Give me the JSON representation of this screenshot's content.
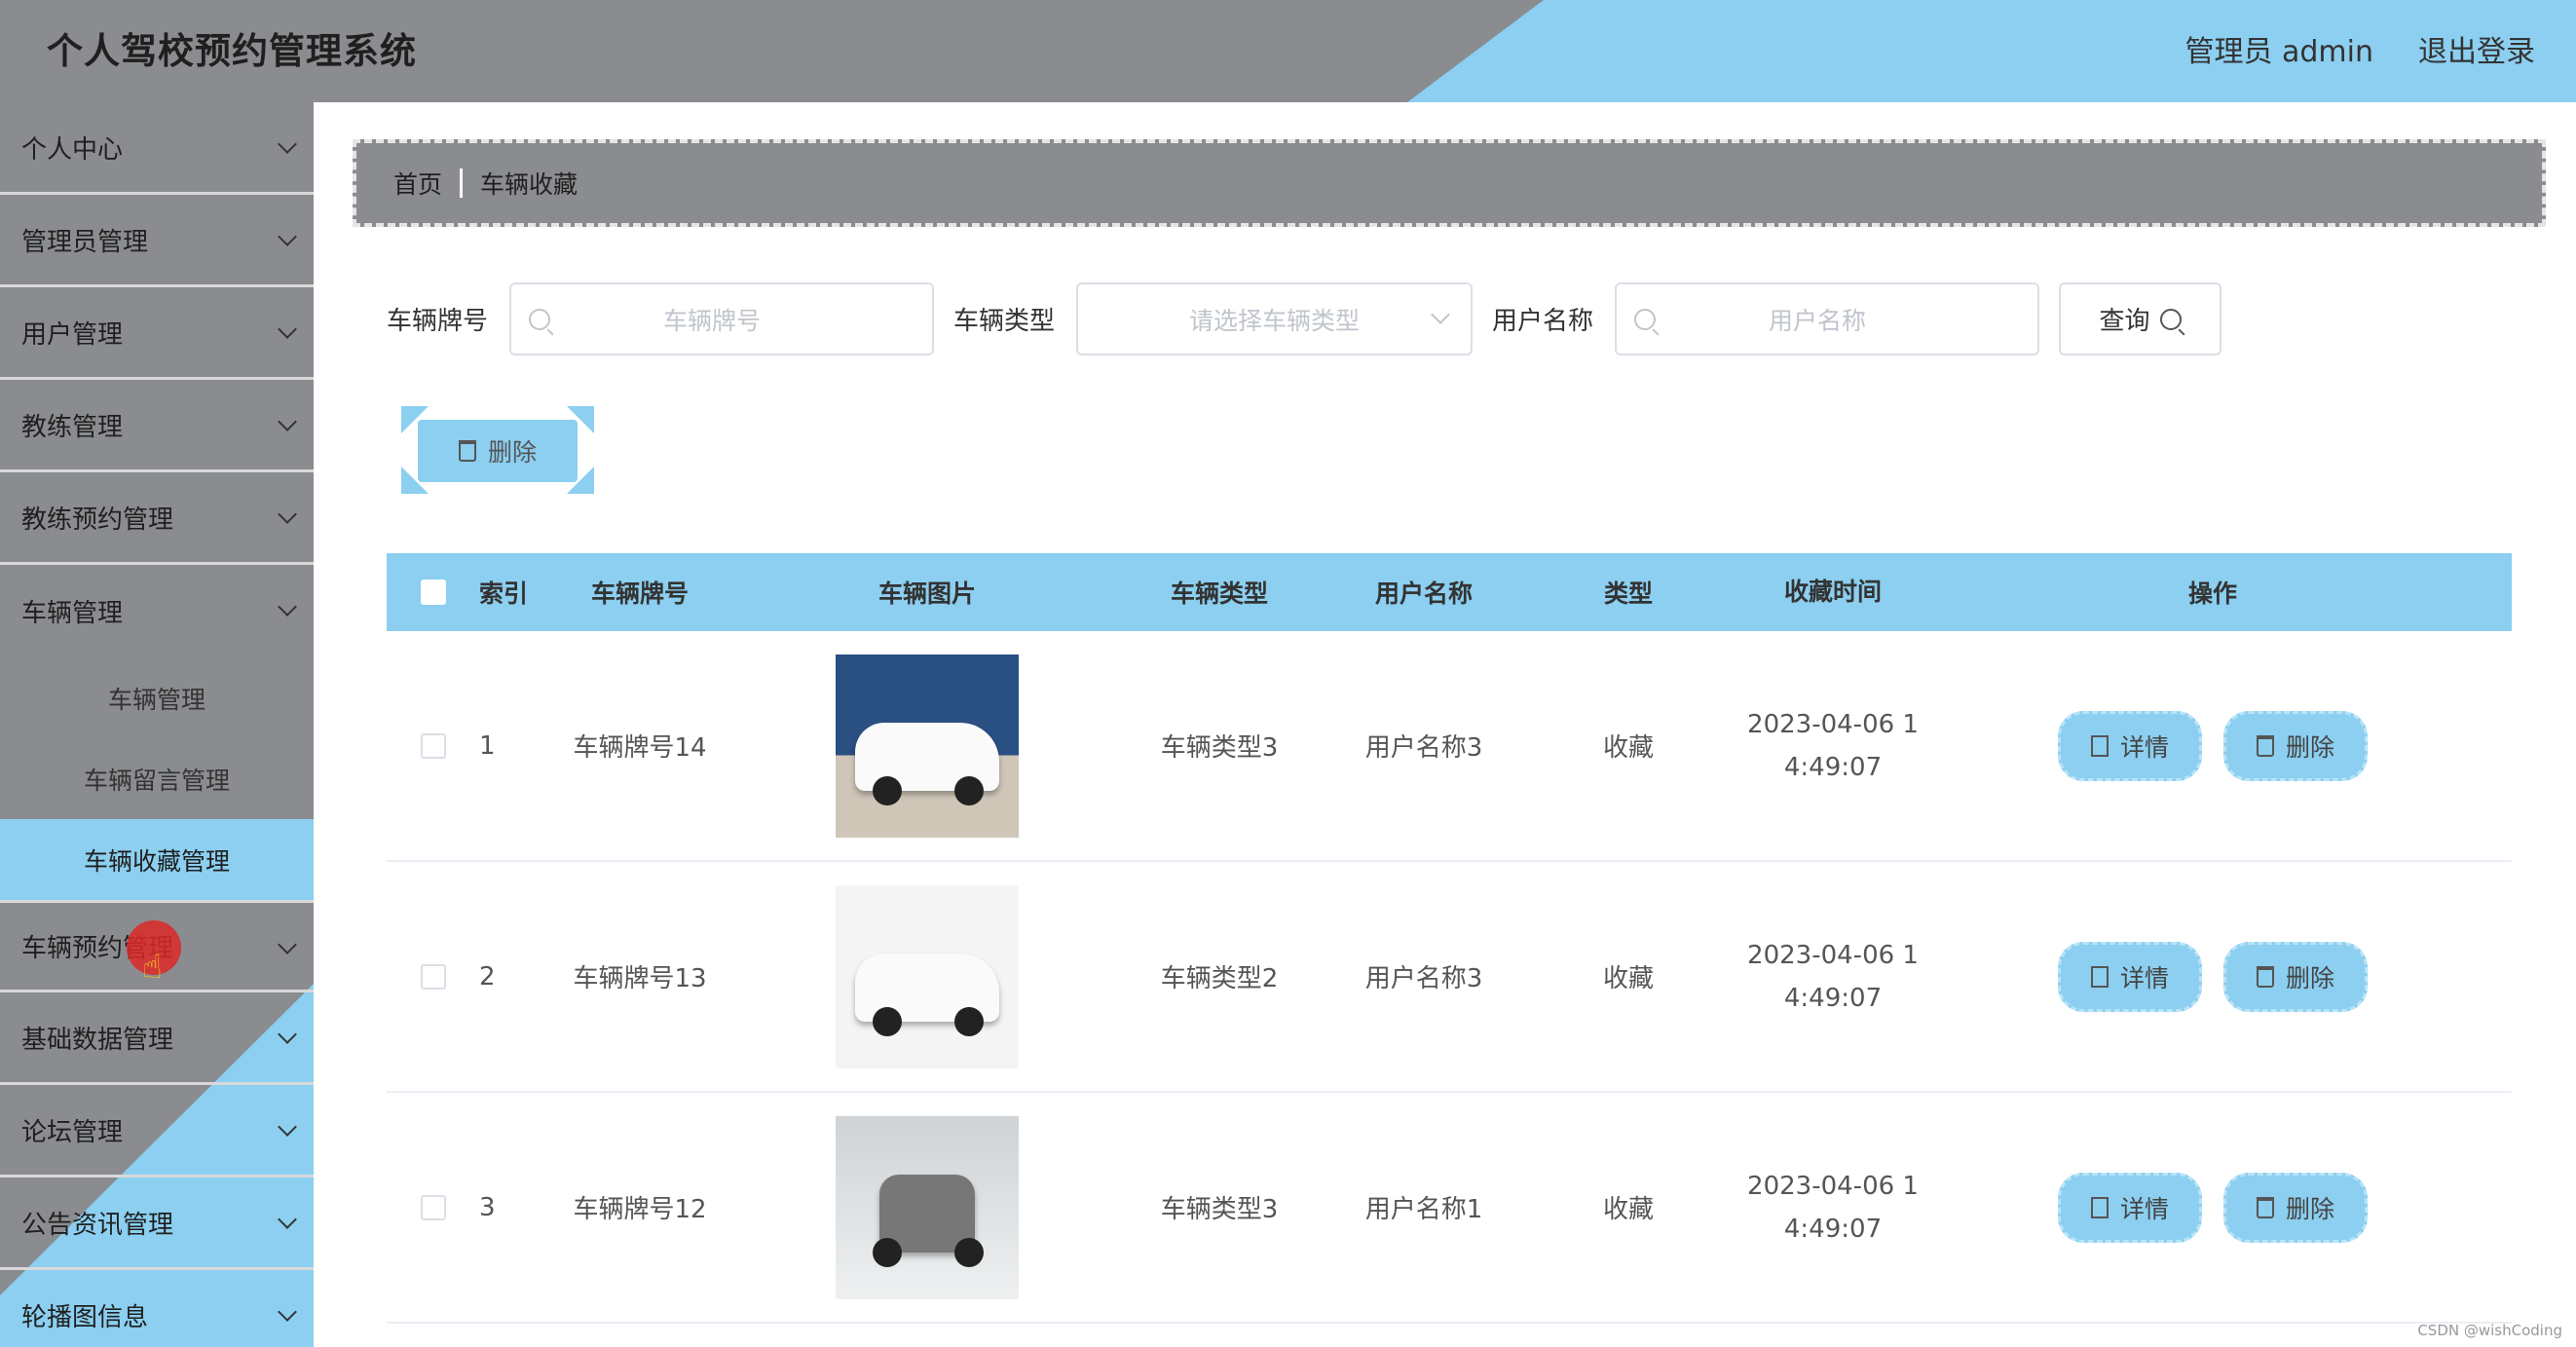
{
  "header": {
    "title": "个人驾校预约管理系统",
    "user": "管理员 admin",
    "logout": "退出登录"
  },
  "sidebar": {
    "items": [
      {
        "label": "个人中心"
      },
      {
        "label": "管理员管理"
      },
      {
        "label": "用户管理"
      },
      {
        "label": "教练管理"
      },
      {
        "label": "教练预约管理"
      },
      {
        "label": "车辆管理"
      }
    ],
    "submenu": [
      "车辆管理",
      "车辆留言管理",
      "车辆收藏管理"
    ],
    "items_after": [
      {
        "label": "车辆预约管理"
      },
      {
        "label": "基础数据管理"
      },
      {
        "label": "论坛管理"
      },
      {
        "label": "公告资讯管理"
      },
      {
        "label": "轮播图信息"
      }
    ]
  },
  "breadcrumb": {
    "home": "首页",
    "current": "车辆收藏"
  },
  "search": {
    "plate_label": "车辆牌号",
    "plate_placeholder": "车辆牌号",
    "type_label": "车辆类型",
    "type_placeholder": "请选择车辆类型",
    "user_label": "用户名称",
    "user_placeholder": "用户名称",
    "query_label": "查询"
  },
  "toolbar": {
    "delete_label": "删除"
  },
  "table": {
    "headers": [
      "索引",
      "车辆牌号",
      "车辆图片",
      "车辆类型",
      "用户名称",
      "类型",
      "收藏时间",
      "操作"
    ],
    "rows": [
      {
        "index": "1",
        "plate": "车辆牌号14",
        "type": "车辆类型3",
        "user": "用户名称3",
        "kind": "收藏",
        "time1": "2023-04-06 1",
        "time2": "4:49:07"
      },
      {
        "index": "2",
        "plate": "车辆牌号13",
        "type": "车辆类型2",
        "user": "用户名称3",
        "kind": "收藏",
        "time1": "2023-04-06 1",
        "time2": "4:49:07"
      },
      {
        "index": "3",
        "plate": "车辆牌号12",
        "type": "车辆类型3",
        "user": "用户名称1",
        "kind": "收藏",
        "time1": "2023-04-06 1",
        "time2": "4:49:07"
      }
    ],
    "detail_label": "详情",
    "delete_label": "删除"
  },
  "watermark": "CSDN @wishCoding",
  "colors": {
    "accent": "#8ccff0",
    "chrome": "#8a8c8f"
  }
}
